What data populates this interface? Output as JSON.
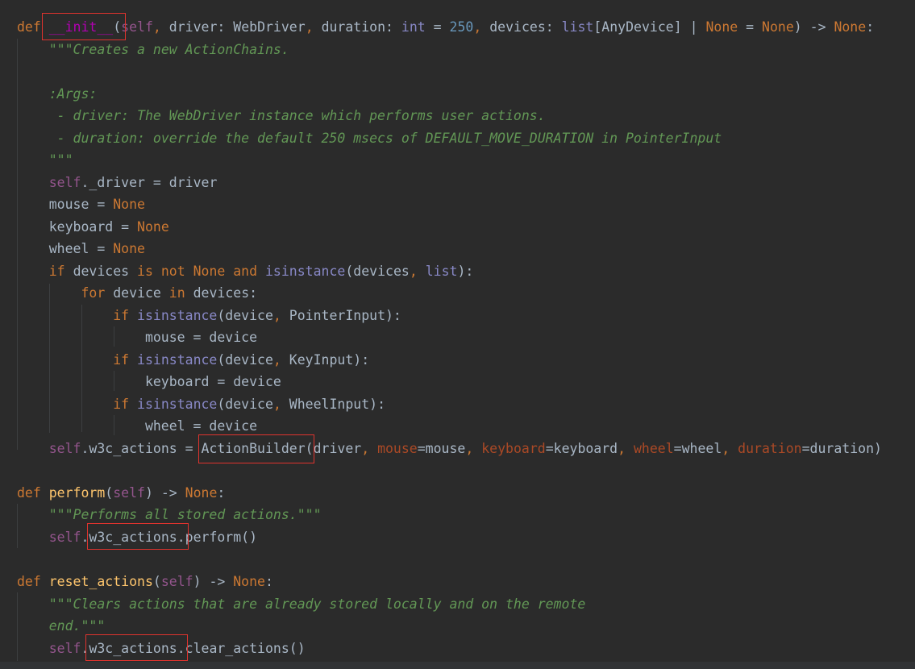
{
  "editor": {
    "theme_colors": {
      "background": "#2b2b2b",
      "keyword": "#cc7832",
      "function": "#ffc66d",
      "magic": "#b200b2",
      "self": "#94558d",
      "builtin": "#8888c6",
      "number": "#6897bb",
      "docstring": "#629755",
      "param": "#aa4926",
      "text": "#a9b7c6",
      "highlight_box": "#e0332e"
    },
    "lines": [
      [
        [
          "kw",
          "def "
        ],
        [
          "mg",
          "__init__"
        ],
        [
          "pl",
          "("
        ],
        [
          "sf",
          "self"
        ],
        [
          "kw",
          ", "
        ],
        [
          "pl",
          "driver: WebDriver"
        ],
        [
          "kw",
          ", "
        ],
        [
          "pl",
          "duration: "
        ],
        [
          "bi",
          "int"
        ],
        [
          "pl",
          " = "
        ],
        [
          "nm",
          "250"
        ],
        [
          "kw",
          ", "
        ],
        [
          "pl",
          "devices: "
        ],
        [
          "bi",
          "list"
        ],
        [
          "pl",
          "[AnyDevice] | "
        ],
        [
          "kw",
          "None"
        ],
        [
          "pl",
          " = "
        ],
        [
          "kw",
          "None"
        ],
        [
          "pl",
          ") -> "
        ],
        [
          "kw",
          "None"
        ],
        [
          "pl",
          ":"
        ]
      ],
      [
        [
          "pl",
          "    "
        ],
        [
          "doc",
          "\"\"\"Creates a new ActionChains."
        ]
      ],
      [],
      [
        [
          "pl",
          "    "
        ],
        [
          "doc",
          ":Args:"
        ]
      ],
      [
        [
          "pl",
          "    "
        ],
        [
          "doc",
          " - driver: The WebDriver instance which performs user actions."
        ]
      ],
      [
        [
          "pl",
          "    "
        ],
        [
          "doc",
          " - duration: override the default 250 msecs of DEFAULT_MOVE_DURATION in PointerInput"
        ]
      ],
      [
        [
          "pl",
          "    "
        ],
        [
          "doc",
          "\"\"\""
        ]
      ],
      [
        [
          "pl",
          "    "
        ],
        [
          "sf",
          "self"
        ],
        [
          "pl",
          "._driver = driver"
        ]
      ],
      [
        [
          "pl",
          "    mouse = "
        ],
        [
          "kw",
          "None"
        ]
      ],
      [
        [
          "pl",
          "    keyboard = "
        ],
        [
          "kw",
          "None"
        ]
      ],
      [
        [
          "pl",
          "    wheel = "
        ],
        [
          "kw",
          "None"
        ]
      ],
      [
        [
          "pl",
          "    "
        ],
        [
          "kw",
          "if "
        ],
        [
          "pl",
          "devices "
        ],
        [
          "kw",
          "is not None and "
        ],
        [
          "bi",
          "isinstance"
        ],
        [
          "pl",
          "(devices"
        ],
        [
          "kw",
          ", "
        ],
        [
          "bi",
          "list"
        ],
        [
          "pl",
          "):"
        ]
      ],
      [
        [
          "pl",
          "        "
        ],
        [
          "kw",
          "for "
        ],
        [
          "pl",
          "device "
        ],
        [
          "kw",
          "in "
        ],
        [
          "pl",
          "devices:"
        ]
      ],
      [
        [
          "pl",
          "            "
        ],
        [
          "kw",
          "if "
        ],
        [
          "bi",
          "isinstance"
        ],
        [
          "pl",
          "(device"
        ],
        [
          "kw",
          ", "
        ],
        [
          "pl",
          "PointerInput):"
        ]
      ],
      [
        [
          "pl",
          "                mouse = device"
        ]
      ],
      [
        [
          "pl",
          "            "
        ],
        [
          "kw",
          "if "
        ],
        [
          "bi",
          "isinstance"
        ],
        [
          "pl",
          "(device"
        ],
        [
          "kw",
          ", "
        ],
        [
          "pl",
          "KeyInput):"
        ]
      ],
      [
        [
          "pl",
          "                keyboard = device"
        ]
      ],
      [
        [
          "pl",
          "            "
        ],
        [
          "kw",
          "if "
        ],
        [
          "bi",
          "isinstance"
        ],
        [
          "pl",
          "(device"
        ],
        [
          "kw",
          ", "
        ],
        [
          "pl",
          "WheelInput):"
        ]
      ],
      [
        [
          "pl",
          "                wheel = device"
        ]
      ],
      [
        [
          "pl",
          "    "
        ],
        [
          "sf",
          "self"
        ],
        [
          "pl",
          ".w3c_actions = ActionBuilder(driver"
        ],
        [
          "kw",
          ", "
        ],
        [
          "pm",
          "mouse"
        ],
        [
          "pl",
          "=mouse"
        ],
        [
          "kw",
          ", "
        ],
        [
          "pm",
          "keyboard"
        ],
        [
          "pl",
          "=keyboard"
        ],
        [
          "kw",
          ", "
        ],
        [
          "pm",
          "wheel"
        ],
        [
          "pl",
          "=wheel"
        ],
        [
          "kw",
          ", "
        ],
        [
          "pm",
          "duration"
        ],
        [
          "pl",
          "=duration)"
        ]
      ],
      [],
      [
        [
          "kw",
          "def "
        ],
        [
          "fn",
          "perform"
        ],
        [
          "pl",
          "("
        ],
        [
          "sf",
          "self"
        ],
        [
          "pl",
          ") -> "
        ],
        [
          "kw",
          "None"
        ],
        [
          "pl",
          ":"
        ]
      ],
      [
        [
          "pl",
          "    "
        ],
        [
          "doc",
          "\"\"\"Performs all stored actions.\"\"\""
        ]
      ],
      [
        [
          "pl",
          "    "
        ],
        [
          "sf",
          "self"
        ],
        [
          "pl",
          ".w3c_actions.perform()"
        ]
      ],
      [],
      [
        [
          "kw",
          "def "
        ],
        [
          "fn",
          "reset_actions"
        ],
        [
          "pl",
          "("
        ],
        [
          "sf",
          "self"
        ],
        [
          "pl",
          ") -> "
        ],
        [
          "kw",
          "None"
        ],
        [
          "pl",
          ":"
        ]
      ],
      [
        [
          "pl",
          "    "
        ],
        [
          "doc",
          "\"\"\"Clears actions that are already stored locally and on the remote"
        ]
      ],
      [
        [
          "pl",
          "    "
        ],
        [
          "doc",
          "end.\"\"\""
        ]
      ],
      [
        [
          "pl",
          "    "
        ],
        [
          "sf",
          "self"
        ],
        [
          "pl",
          ".w3c_actions.clear_actions()"
        ]
      ]
    ]
  }
}
